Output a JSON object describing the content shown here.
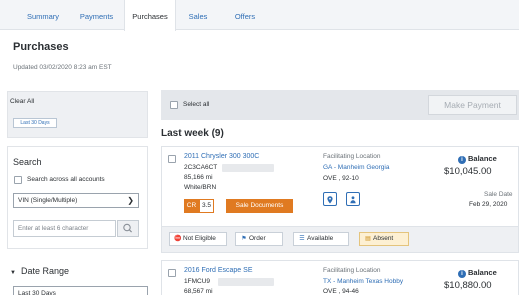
{
  "tabs": [
    "Summary",
    "Payments",
    "Purchases",
    "Sales",
    "Offers"
  ],
  "active_tab": "Purchases",
  "page": {
    "title": "Purchases",
    "updated": "Updated 03/02/2020 8:23 am EST"
  },
  "filters": {
    "clear_all": "Clear All",
    "chip": "Last 30 Days"
  },
  "search": {
    "heading": "Search",
    "across_label": "Search across all accounts",
    "type_select": "VIN (Single/Multiple)",
    "input_placeholder": "Enter at least 6 character",
    "date_range": "Date Range",
    "date_select": "Last 30 Days"
  },
  "actions": {
    "select_all": "Select all",
    "make_payment": "Make Payment"
  },
  "group_title": "Last week (9)",
  "vehicles": [
    {
      "title": "2011 Chrysler 300 300C",
      "vin": "2C3CA6CT",
      "mileage": "85,166 mi",
      "color": "White/BRN",
      "location_label": "Facilitating Location",
      "location": "GA - Manheim Georgia",
      "ove": "OVE , 92-10",
      "balance_label": "Balance",
      "balance": "$10,045.00",
      "sale_date_label": "Sale Date",
      "sale_date": "Feb 29, 2020",
      "cr_label": "CR",
      "cr_value": "3.5",
      "sale_docs": "Sale Documents",
      "statuses": [
        "Not Eligible",
        "Order",
        "Available",
        "Absent"
      ]
    },
    {
      "title": "2016 Ford Escape SE",
      "vin": "1FMCU9",
      "mileage": "68,567 mi",
      "location_label": "Facilitating Location",
      "location": "TX - Manheim Texas Hobby",
      "ove": "OVE , 94-46",
      "balance_label": "Balance",
      "balance": "$10,880.00"
    }
  ],
  "colors": {
    "link": "#2f6eb5",
    "accent_orange": "#e07a21",
    "absent_bg": "#fdf0d3"
  }
}
